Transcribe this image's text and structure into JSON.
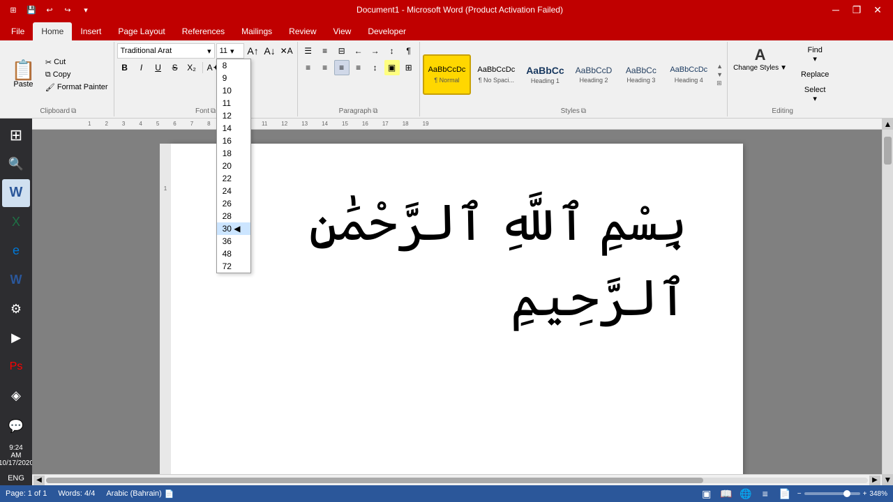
{
  "title_bar": {
    "title": "Document1 - Microsoft Word (Product Activation Failed)",
    "bg_color": "#c00000"
  },
  "ribbon_tabs": {
    "tabs": [
      "File",
      "Home",
      "Insert",
      "Page Layout",
      "References",
      "Mailings",
      "Review",
      "View",
      "Developer"
    ],
    "active": "Home"
  },
  "clipboard": {
    "paste_label": "Paste",
    "cut_label": "Cut",
    "copy_label": "Copy",
    "format_painter_label": "Format Painter",
    "group_label": "Clipboard"
  },
  "font": {
    "name": "Traditional Arat",
    "size": "11",
    "group_label": "Font",
    "sizes": [
      "8",
      "9",
      "10",
      "11",
      "12",
      "14",
      "16",
      "18",
      "20",
      "22",
      "24",
      "26",
      "28",
      "30",
      "36",
      "48",
      "72"
    ],
    "size_dropdown_visible": true,
    "highlighted_size": "30"
  },
  "paragraph": {
    "group_label": "Paragraph"
  },
  "styles": {
    "group_label": "Styles",
    "items": [
      {
        "id": "normal",
        "preview": "AaBbCcDc",
        "label": "¶ Normal",
        "active": true
      },
      {
        "id": "no-spacing",
        "preview": "AaBbCcDc",
        "label": "¶ No Spaci...",
        "active": false
      },
      {
        "id": "heading1",
        "preview": "AaBbCc",
        "label": "Heading 1",
        "active": false
      },
      {
        "id": "heading2",
        "preview": "AaBbCcD",
        "label": "Heading 2",
        "active": false
      },
      {
        "id": "heading3",
        "preview": "AaBbCc",
        "label": "Heading 3",
        "active": false
      },
      {
        "id": "heading4",
        "preview": "AaBbCcDc",
        "label": "Heading 4",
        "active": false
      }
    ]
  },
  "change_styles": {
    "label": "Change Styles",
    "arrow": "▼"
  },
  "editing": {
    "find_label": "Find",
    "replace_label": "Replace",
    "select_label": "Select",
    "group_label": "Editing"
  },
  "document": {
    "content": "بِسْمِ ٱللَّهِ ٱلرَّحْمَٰنِ ٱلرَّحِيمِ"
  },
  "status_bar": {
    "page_info": "Page: 1 of 1",
    "words": "Words: 4/4",
    "language": "Arabic (Bahrain)",
    "zoom": "348%"
  },
  "window_controls": {
    "minimize": "─",
    "restore": "❐",
    "close": "✕"
  }
}
